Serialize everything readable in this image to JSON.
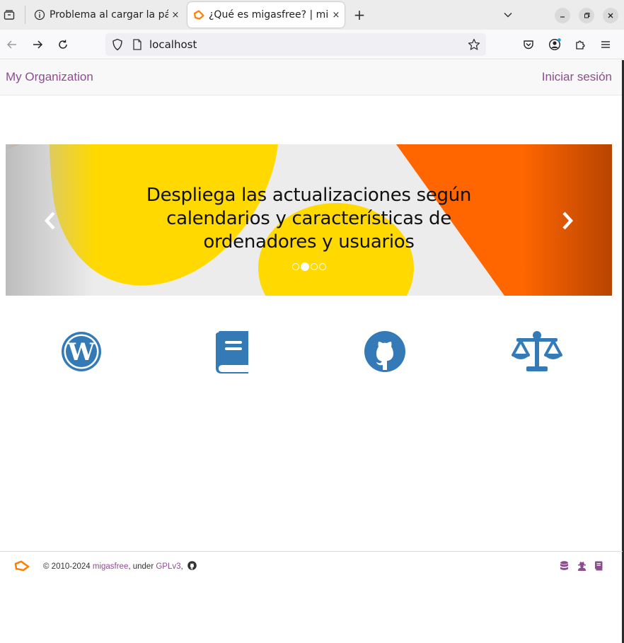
{
  "browser": {
    "tabs": [
      {
        "title": "Problema al cargar la pág",
        "icon": "info-icon",
        "active": false
      },
      {
        "title": "¿Qué es migasfree? | miga",
        "icon": "migasfree-favicon",
        "active": true
      }
    ],
    "close_glyph": "×",
    "new_tab_glyph": "+",
    "url": "localhost"
  },
  "header": {
    "brand": "My Organization",
    "login": "Iniciar sesión"
  },
  "carousel": {
    "caption": "Despliega las actualizaciones según calendarios y características de ordenadores y usuarios",
    "slides": 4,
    "active_index": 1,
    "colors": {
      "yellow": "#ffd900",
      "orange": "#ff6600",
      "light": "#ececec"
    }
  },
  "features": [
    {
      "icon": "wordpress-icon"
    },
    {
      "icon": "book-icon"
    },
    {
      "icon": "github-icon"
    },
    {
      "icon": "balance-scale-icon"
    }
  ],
  "footer": {
    "copyright": "© 2010-2024 ",
    "project_link": "migasfree",
    "under": ", under ",
    "license_link": "GPLv3",
    "comma": ","
  },
  "colors": {
    "accent": "#8e4c90",
    "icon_blue": "#337ab7"
  }
}
